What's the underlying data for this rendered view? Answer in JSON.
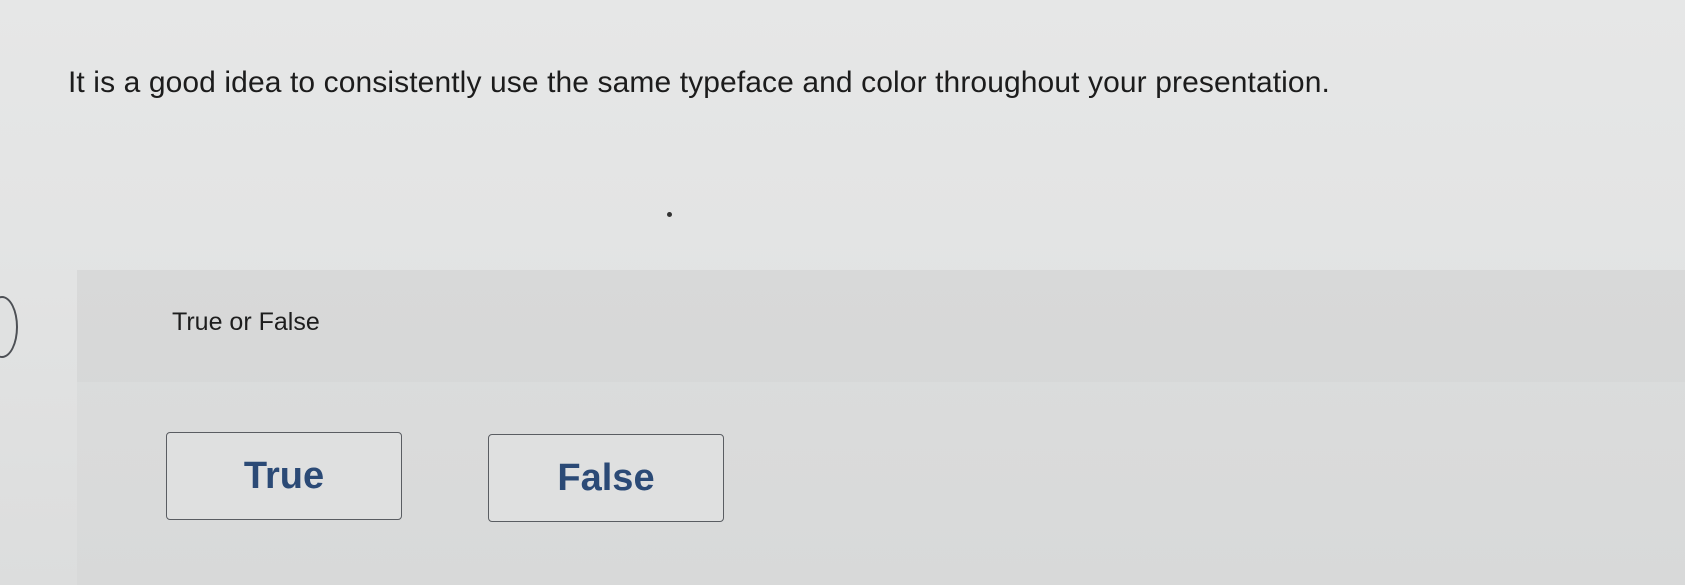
{
  "question": {
    "text": "It is a good idea to consistently use the same typeface and color throughout your presentation."
  },
  "answer_panel": {
    "prompt": "True or False",
    "options": [
      {
        "label": "True"
      },
      {
        "label": "False"
      }
    ]
  },
  "colors": {
    "button_text": "#2b4a76",
    "button_border": "#5a5d62",
    "page_background": "#e4e5e5",
    "panel_background": "#dadbdb"
  }
}
